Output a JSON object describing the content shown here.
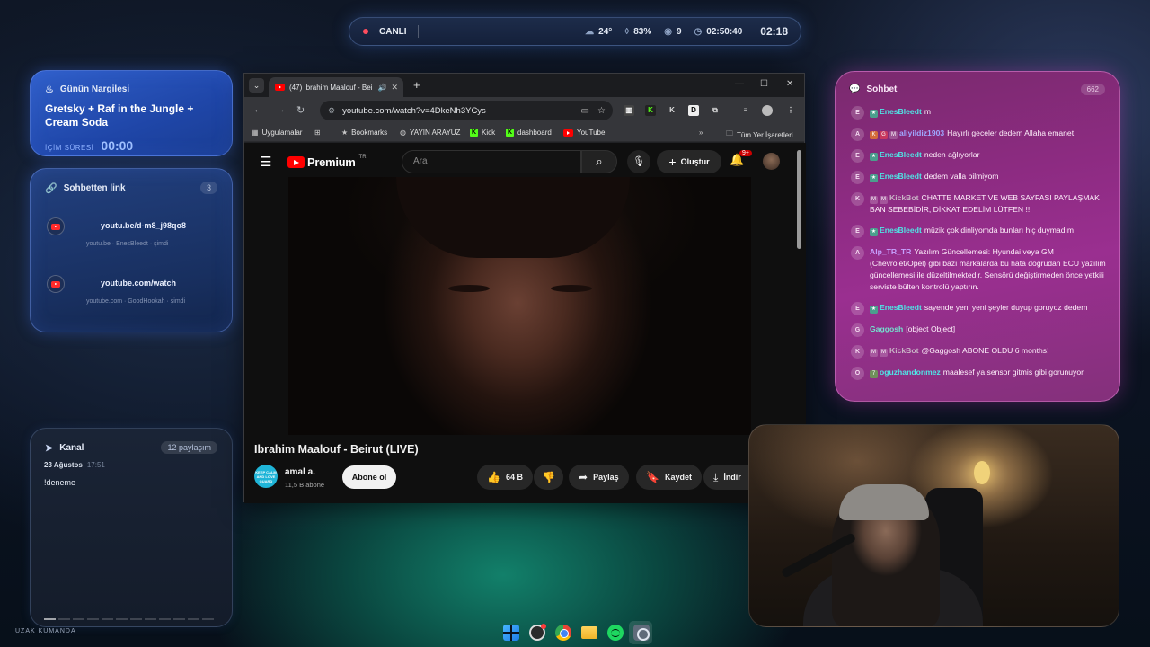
{
  "topbar": {
    "live_label": "CANLI",
    "temperature": "24°",
    "humidity": "83%",
    "viewers": "9",
    "uptime": "02:50:40",
    "clock": "02:18"
  },
  "nargile_card": {
    "heading": "Günün Nargilesi",
    "flavor": "Gretsky + Raf in the Jungle + Cream Soda",
    "timer_label": "İÇİM SÜRESİ",
    "timer_value": "00:00"
  },
  "link_card": {
    "heading": "Sohbetten link",
    "count": "3",
    "links": [
      {
        "url": "youtu.be/d-m8_j98qo8",
        "meta": "youtu.be · EnesBleedt · şimdi"
      },
      {
        "url": "youtube.com/watch",
        "meta": "youtube.com · GoodHookah · şimdi"
      }
    ]
  },
  "kanal_card": {
    "heading": "Kanal",
    "share_count": "12 paylaşım",
    "date": "23 Ağustos",
    "time": "17:51",
    "message": "!deneme"
  },
  "footer_label": "UZAK KUMANDA",
  "browser": {
    "tab_title": "(47) Ibrahim Maalouf - Beiru",
    "url": "youtube.com/watch?v=4DkeNh3YCys",
    "bookmarks": [
      {
        "label": "Uygulamalar",
        "icon": "grid-icon"
      },
      {
        "label": "Bookmarks",
        "icon": "star-icon"
      },
      {
        "label": "YAYIN ARAYÜZ",
        "icon": "globe-icon"
      },
      {
        "label": "Kick",
        "icon": "kick-icon"
      },
      {
        "label": "dashboard",
        "icon": "kick-icon"
      },
      {
        "label": "YouTube",
        "icon": "youtube-icon"
      }
    ],
    "all_bookmarks": "Tüm Yer İşaretleri"
  },
  "youtube": {
    "logo_text": "Premium",
    "logo_region": "TR",
    "search_placeholder": "Ara",
    "create_label": "Oluştur",
    "notif_badge": "9+",
    "video_title": "Ibrahim Maalouf - Beirut (LIVE)",
    "channel_name": "amal a.",
    "channel_subs": "11,5 B abone",
    "subscribe_label": "Abone ol",
    "like_count": "64 B",
    "share_label": "Paylaş",
    "save_label": "Kaydet",
    "download_label": "İndir",
    "channel_avatar_text": "KEEP CALM AND LOVE GUARD"
  },
  "chat": {
    "heading": "Sohbet",
    "count": "662",
    "messages": [
      {
        "initial": "E",
        "badges": [
          "star"
        ],
        "user": "EnesBleedt",
        "color": "cyan",
        "text": "m"
      },
      {
        "initial": "A",
        "badges": [
          "k",
          "g",
          "m"
        ],
        "user": "aliyildiz1903",
        "color": "blue",
        "text": "Hayırlı geceler dedem Allaha emanet"
      },
      {
        "initial": "E",
        "badges": [
          "star"
        ],
        "user": "EnesBleedt",
        "color": "cyan",
        "text": "neden ağlıyorlar"
      },
      {
        "initial": "E",
        "badges": [
          "star"
        ],
        "user": "EnesBleedt",
        "color": "cyan",
        "text": "dedem valla bilmiyom"
      },
      {
        "initial": "K",
        "badges": [
          "m",
          "m"
        ],
        "user": "KickBot",
        "color": "grey",
        "text": "CHATTE MARKET VE WEB SAYFASI PAYLAŞMAK BAN SEBEBİDİR, DİKKAT EDELİM LÜTFEN !!!"
      },
      {
        "initial": "E",
        "badges": [
          "star"
        ],
        "user": "EnesBleedt",
        "color": "cyan",
        "text": "müzik çok dinliyomda bunları hiç duymadım"
      },
      {
        "initial": "A",
        "badges": [],
        "user": "Alp_TR_TR",
        "color": "lilac",
        "text": "Yazılım Güncellemesi: Hyundai veya GM (Chevrolet/Opel) gibi bazı markalarda bu hata doğrudan ECU yazılım güncellemesi ile düzeltilmektedir. Sensörü değiştirmeden önce yetkili serviste bülten kontrolü yaptırın."
      },
      {
        "initial": "E",
        "badges": [
          "star"
        ],
        "user": "EnesBleedt",
        "color": "cyan",
        "text": "sayende yeni yeni şeyler duyup goruyoz dedem"
      },
      {
        "initial": "G",
        "badges": [],
        "user": "Gaggosh",
        "color": "teal",
        "text": "[object Object]"
      },
      {
        "initial": "K",
        "badges": [
          "m",
          "m"
        ],
        "user": "KickBot",
        "color": "grey",
        "text": "@Gaggosh ABONE OLDU 6 months!"
      },
      {
        "initial": "O",
        "badges": [
          "7"
        ],
        "user": "oguzhandonmez",
        "color": "cyan",
        "text": "maalesef ya sensor gitmis gibi gorunuyor"
      }
    ]
  }
}
